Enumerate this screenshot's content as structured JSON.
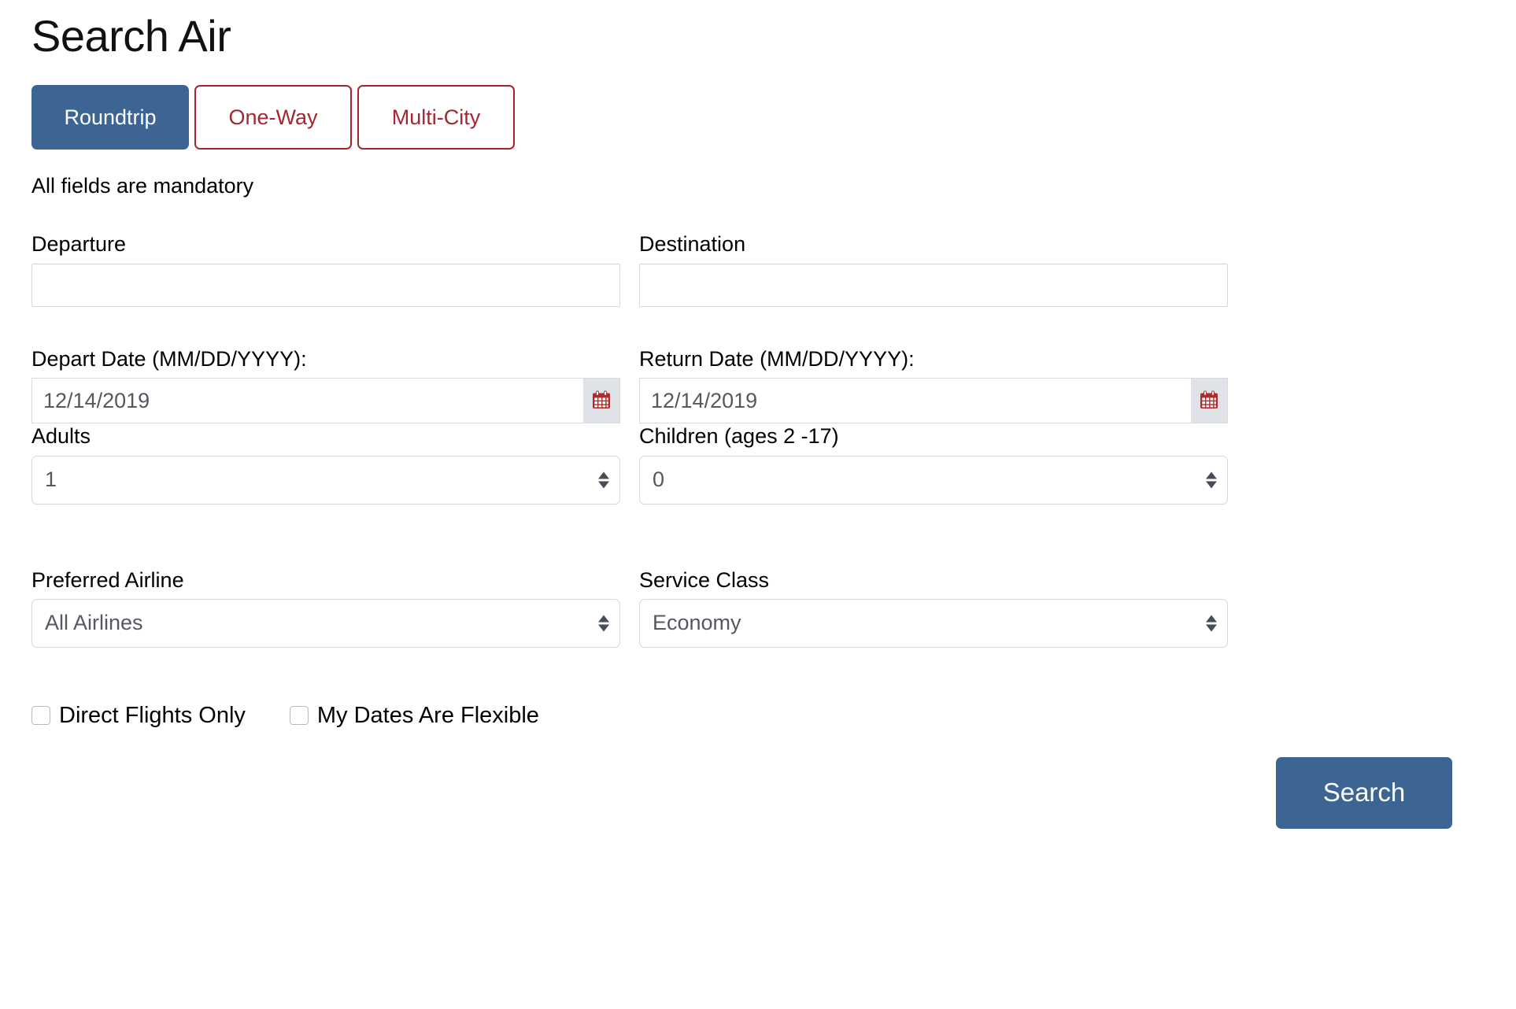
{
  "page": {
    "title": "Search Air",
    "mandatory_note": "All fields are mandatory"
  },
  "colors": {
    "primary_blue": "#3d6593",
    "accent_red": "#a42730",
    "input_border": "#d8dade",
    "calendar_button_bg": "#dfe3e8",
    "text": "#000000",
    "input_text": "#55595f"
  },
  "trip_tabs": [
    {
      "label": "Roundtrip",
      "active": true
    },
    {
      "label": "One-Way",
      "active": false
    },
    {
      "label": "Multi-City",
      "active": false
    }
  ],
  "fields": {
    "departure": {
      "label": "Departure",
      "value": "",
      "placeholder": ""
    },
    "destination": {
      "label": "Destination",
      "value": "",
      "placeholder": ""
    },
    "depart_date": {
      "label": "Depart Date (MM/DD/YYYY):",
      "value": "12/14/2019",
      "calendar_icon": "calendar-icon"
    },
    "return_date": {
      "label": "Return Date (MM/DD/YYYY):",
      "value": "12/14/2019",
      "calendar_icon": "calendar-icon"
    },
    "adults": {
      "label": "Adults",
      "value": "1"
    },
    "children": {
      "label": "Children (ages 2 -17)",
      "value": "0"
    },
    "preferred_airline": {
      "label": "Preferred Airline",
      "value": "All Airlines"
    },
    "service_class": {
      "label": "Service Class",
      "value": "Economy"
    }
  },
  "checkboxes": [
    {
      "label": "Direct Flights Only",
      "checked": false
    },
    {
      "label": "My Dates Are Flexible",
      "checked": false
    }
  ],
  "actions": {
    "search_label": "Search"
  }
}
